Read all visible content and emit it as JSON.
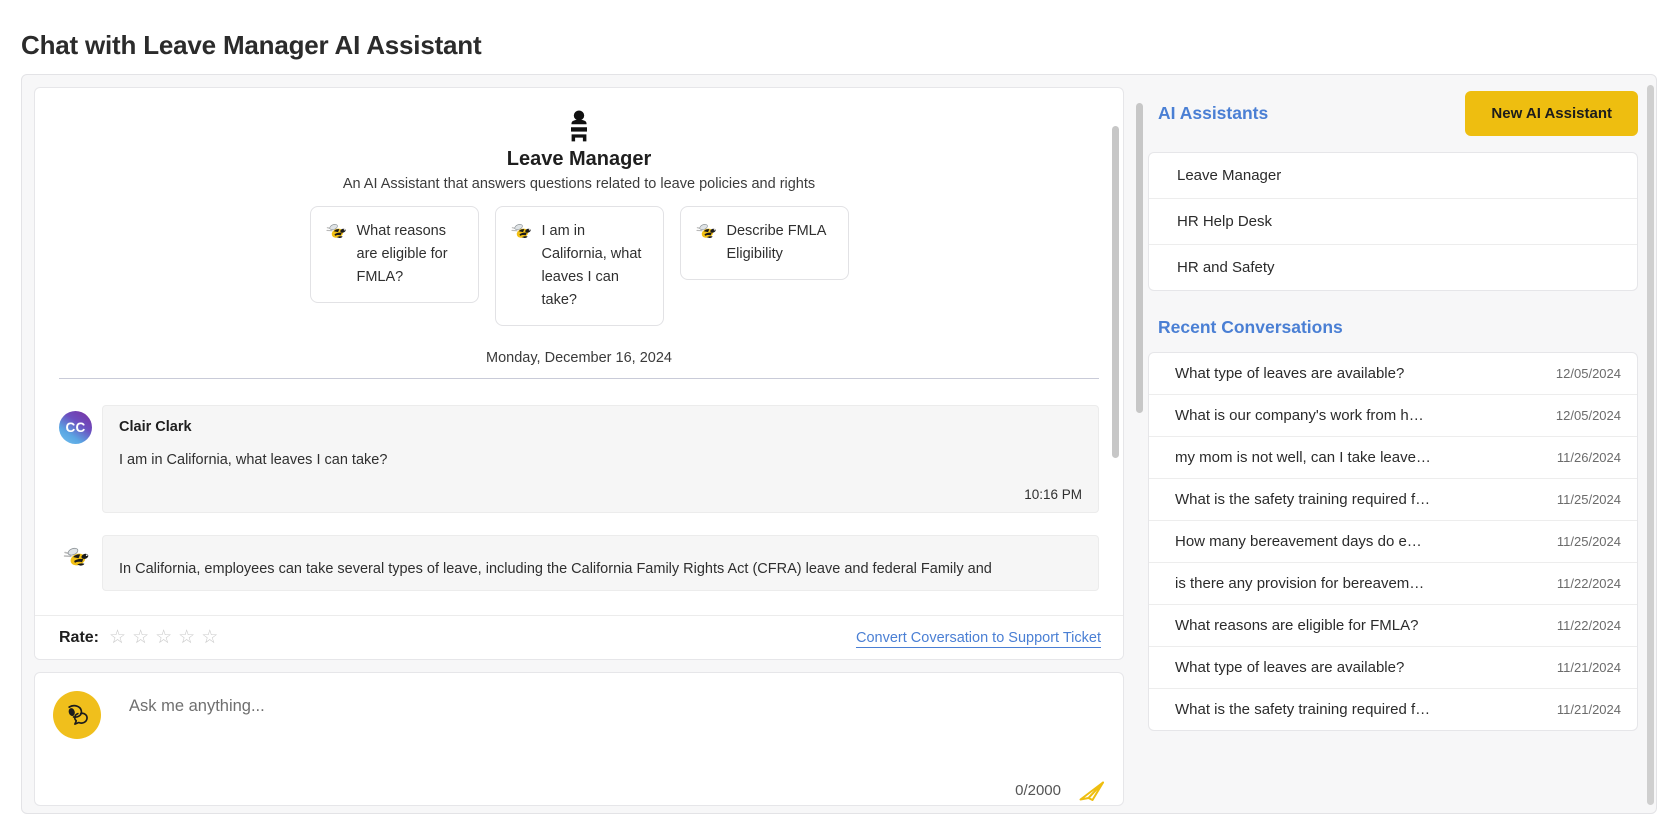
{
  "page": {
    "title": "Chat with Leave Manager AI Assistant"
  },
  "assistant_intro": {
    "logo_icon": "bee-logo-icon",
    "name": "Leave Manager",
    "description": "An AI Assistant that answers questions related to leave policies and rights",
    "suggestions": [
      {
        "icon": "bee-icon",
        "text": "What reasons are eligible for FMLA?"
      },
      {
        "icon": "bee-icon",
        "text": "I am in California, what leaves I can take?"
      },
      {
        "icon": "bee-icon",
        "text": "Describe FMLA Eligibility"
      }
    ]
  },
  "conversation": {
    "date_separator": "Monday, December 16, 2024",
    "messages": [
      {
        "author": "Clair Clark",
        "avatar_initials": "CC",
        "avatar_type": "initials",
        "body": "I am in California, what leaves I can take?",
        "time": "10:16 PM"
      },
      {
        "author": "",
        "avatar_initials": "",
        "avatar_type": "bee-icon",
        "body": "In California, employees can take several types of leave, including the California Family Rights Act (CFRA) leave and federal Family and",
        "time": ""
      }
    ]
  },
  "rate_bar": {
    "label": "Rate:",
    "star_count": 5,
    "stars_filled": 0,
    "star_glyph": "☆",
    "convert_link": "Convert Coversation to Support Ticket"
  },
  "composer": {
    "avatar_icon": "chat-bubble-icon",
    "placeholder": "Ask me anything...",
    "value": "",
    "char_counter": "0/2000",
    "send_icon": "send-paper-plane-icon"
  },
  "sidebar": {
    "assistants_title": "AI Assistants",
    "new_assistant_button": "New AI Assistant",
    "assistants": [
      {
        "label": "Leave Manager"
      },
      {
        "label": "HR Help Desk"
      },
      {
        "label": "HR and Safety"
      }
    ],
    "recent_title": "Recent Conversations",
    "recent_conversations": [
      {
        "text": "What type of leaves are available?",
        "date": "12/05/2024"
      },
      {
        "text": "What is our company's work from h…",
        "date": "12/05/2024"
      },
      {
        "text": "my mom is not well, can I take leave…",
        "date": "11/26/2024"
      },
      {
        "text": "What is the safety training required f…",
        "date": "11/25/2024"
      },
      {
        "text": "How many bereavement days do e…",
        "date": "11/25/2024"
      },
      {
        "text": "is there any provision for bereavem…",
        "date": "11/22/2024"
      },
      {
        "text": "What reasons are eligible for FMLA?",
        "date": "11/22/2024"
      },
      {
        "text": "What type of leaves are available?",
        "date": "11/21/2024"
      },
      {
        "text": "What is the safety training required f…",
        "date": "11/21/2024"
      }
    ]
  },
  "colors": {
    "accent_yellow": "#eebe10",
    "link_blue": "#4a7fd4",
    "bubble_bg": "#f6f6f6",
    "shell_bg": "#f7f7f8"
  }
}
